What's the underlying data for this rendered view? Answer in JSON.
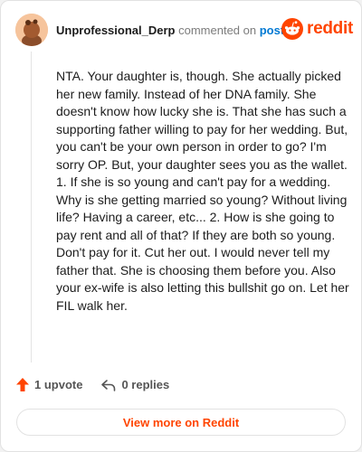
{
  "comment": {
    "username": "Unprofessional_Derp",
    "commented_on": "commented on",
    "post_link": "post",
    "text": "NTA. Your daughter is, though. She actually picked her new family. Instead of her DNA family. She doesn't know how lucky she is. That she has such a supporting father willing to pay for her wedding. But, you can't be your own person in order to go? I'm sorry OP. But, your daughter sees you as the wallet. 1. If she is so young and can't pay for a wedding. Why is she getting married so young? Without living life? Having a career, etc... 2. How is she going to pay rent and all of that? If they are both so young. Don't pay for it. Cut her out. I would never tell my father that. She is choosing them before you. Also your ex-wife is also letting this bullshit go on. Let her FIL walk her."
  },
  "branding": {
    "wordmark": "reddit",
    "brand_color": "#ff4500",
    "link_color": "#0079d3"
  },
  "actions": {
    "upvote_label": "1 upvote",
    "replies_label": "0 replies",
    "upvote_icon": "upvote-arrow-icon",
    "reply_icon": "reply-icon"
  },
  "footer": {
    "view_more_label": "View more on Reddit"
  }
}
